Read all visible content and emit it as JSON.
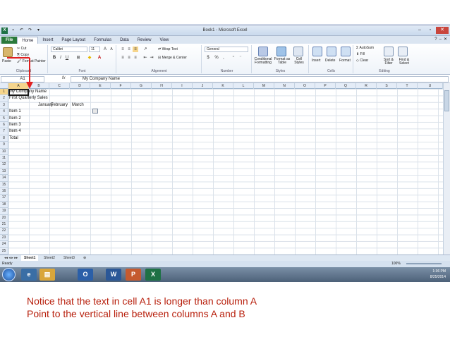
{
  "window": {
    "title": "Book1 - Microsoft Excel"
  },
  "tabs": [
    "File",
    "Home",
    "Insert",
    "Page Layout",
    "Formulas",
    "Data",
    "Review",
    "View"
  ],
  "ribbon": {
    "clipboard": {
      "cut": "Cut",
      "copy": "Copy",
      "format_painter": "Format Painter",
      "paste": "Paste",
      "label": "Clipboard"
    },
    "font": {
      "name": "Calibri",
      "size": "11",
      "label": "Font",
      "bold": "B",
      "italic": "I",
      "underline": "U"
    },
    "alignment": {
      "wrap_text": "Wrap Text",
      "merge_center": "Merge & Center",
      "label": "Alignment"
    },
    "number": {
      "format": "General",
      "currency": "$",
      "percent": "%",
      "comma": ",",
      "label": "Number"
    },
    "styles": {
      "conditional": "Conditional Formatting",
      "format_table": "Format as Table",
      "cell_styles": "Cell Styles",
      "label": "Styles"
    },
    "cells": {
      "insert": "Insert",
      "delete": "Delete",
      "format": "Format",
      "label": "Cells"
    },
    "editing": {
      "autosum": "AutoSum",
      "fill": "Fill",
      "clear": "Clear",
      "sort_filter": "Sort & Filter",
      "find_select": "Find & Select",
      "label": "Editing"
    }
  },
  "formula_bar": {
    "name_box": "A1",
    "fx": "fx",
    "content": "My Company Name"
  },
  "columns": [
    "A",
    "B",
    "C",
    "D",
    "E",
    "F",
    "G",
    "H",
    "I",
    "J",
    "K",
    "L",
    "M",
    "N",
    "O",
    "P",
    "Q",
    "R",
    "S",
    "T",
    "U"
  ],
  "rows": [
    "1",
    "2",
    "3",
    "4",
    "5",
    "6",
    "7",
    "8",
    "9",
    "10",
    "11",
    "12",
    "13",
    "14",
    "15",
    "16",
    "17",
    "18",
    "19",
    "20",
    "21",
    "22",
    "23",
    "24",
    "25"
  ],
  "cells": {
    "a1": "My Company Name",
    "a2": "First Quarterly Sales",
    "b3": "January",
    "c3": "February",
    "d3": "March",
    "a4": "Item 1",
    "a5": "Item 2",
    "a6": "Item 3",
    "a7": "Item 4",
    "a8": "Total"
  },
  "sheets": [
    "Sheet1",
    "Sheet2",
    "Sheet3"
  ],
  "status": {
    "ready": "Ready",
    "zoom": "100%"
  },
  "taskbar": {
    "time": "1:36 PM",
    "date": "8/25/2014"
  },
  "caption": {
    "line1": "Notice that the text in cell A1 is longer than column A",
    "line2": "Point to the vertical line between columns A and B"
  },
  "colors": {
    "accent": "#1e7145",
    "caption": "#b8200d",
    "arrow": "#e02020"
  }
}
